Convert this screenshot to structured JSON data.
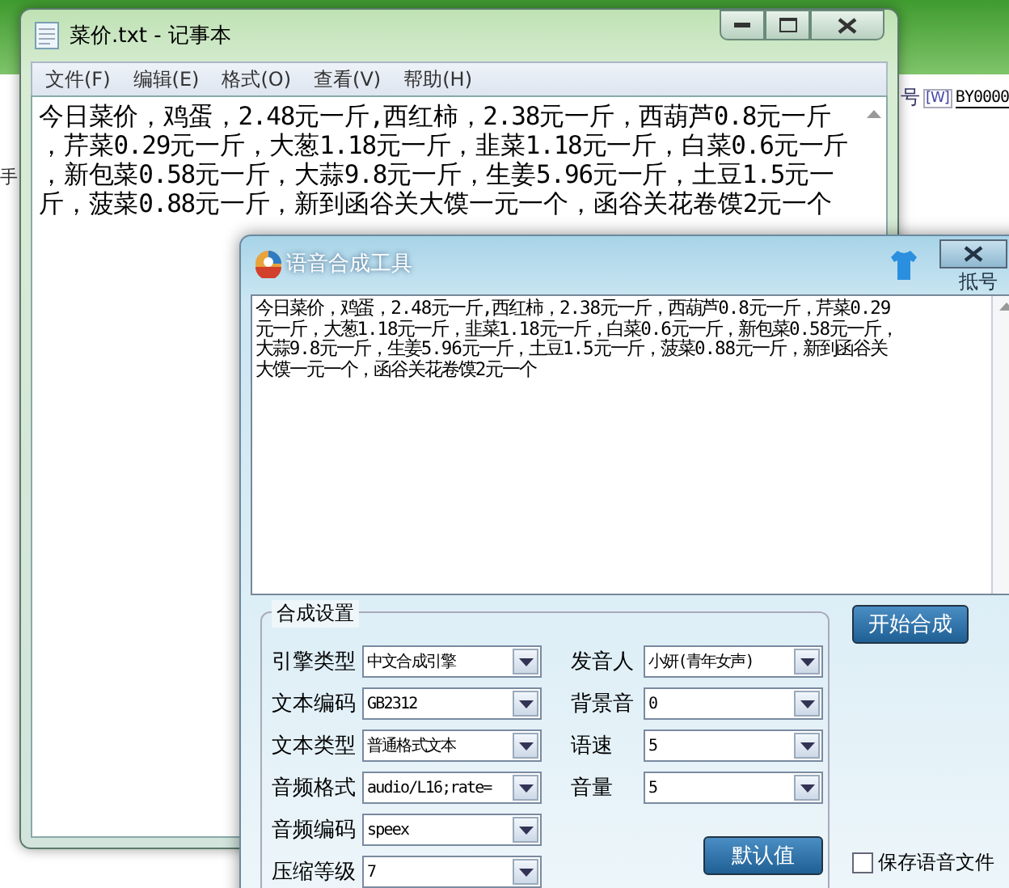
{
  "background_app": {
    "field_label": "号",
    "field_hint": "[W]",
    "field_value": "BY0000",
    "side_text": "手",
    "behind_label": "抵号"
  },
  "notepad": {
    "title": "菜价.txt - 记事本",
    "menu": [
      "文件(F)",
      "编辑(E)",
      "格式(O)",
      "查看(V)",
      "帮助(H)"
    ],
    "lines": [
      "今日菜价，鸡蛋，2.48元一斤,西红柿，2.38元一斤，西葫芦0.8元一斤",
      "，芹菜0.29元一斤，大葱1.18元一斤，韭菜1.18元一斤，白菜0.6元一斤",
      "，新包菜0.58元一斤，大蒜9.8元一斤，生姜5.96元一斤，土豆1.5元一",
      "斤，菠菜0.88元一斤，新到函谷关大馍一元一个，函谷关花卷馍2元一个"
    ]
  },
  "tts": {
    "title": "语音合成工具",
    "text_lines": [
      "今日菜价，鸡蛋，2.48元一斤,西红柿，2.38元一斤，西葫芦0.8元一斤，芹菜0.29",
      "元一斤，大葱1.18元一斤，韭菜1.18元一斤，白菜0.6元一斤，新包菜0.58元一斤，",
      "大蒜9.8元一斤，生姜5.96元一斤，土豆1.5元一斤，菠菜0.88元一斤，新到函谷关",
      "大馍一元一个，函谷关花卷馍2元一个"
    ],
    "group_title": "合成设置",
    "left_fields": [
      {
        "label": "引擎类型",
        "value": "中文合成引擎"
      },
      {
        "label": "文本编码",
        "value": "GB2312"
      },
      {
        "label": "文本类型",
        "value": "普通格式文本"
      },
      {
        "label": "音频格式",
        "value": "audio/L16;rate="
      },
      {
        "label": "音频编码",
        "value": "speex"
      },
      {
        "label": "压缩等级",
        "value": "7"
      }
    ],
    "right_fields": [
      {
        "label": "发音人",
        "value": "小妍(青年女声)"
      },
      {
        "label": "背景音",
        "value": "0"
      },
      {
        "label": "语速",
        "value": "5"
      },
      {
        "label": "音量",
        "value": "5"
      }
    ],
    "start_button": "开始合成",
    "default_button": "默认值",
    "save_checkbox": {
      "label": "保存语音文件",
      "checked": false
    }
  }
}
